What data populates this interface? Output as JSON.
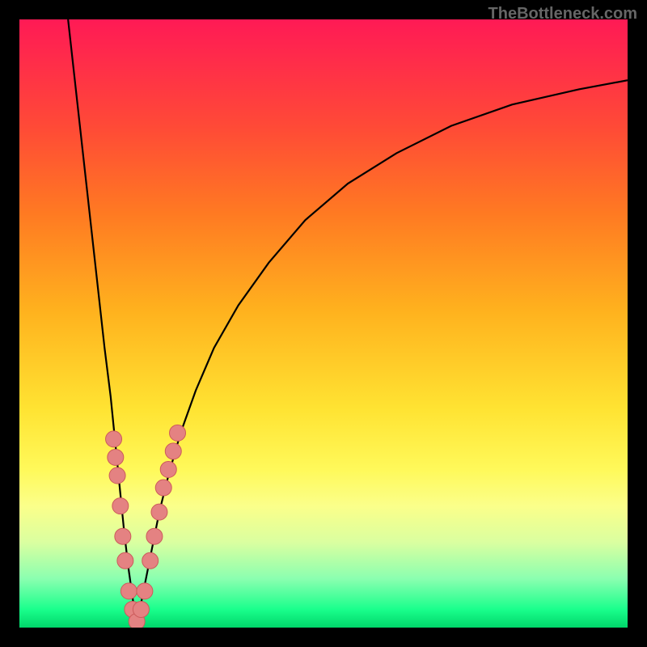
{
  "watermark": "TheBottleneck.com",
  "colors": {
    "frame": "#000000",
    "curve": "#000000",
    "marker_fill": "#e48282",
    "marker_stroke": "#cc5b5b",
    "gradient_stops": [
      {
        "offset": 0.0,
        "color": "#ff1a55"
      },
      {
        "offset": 0.06,
        "color": "#ff2a4b"
      },
      {
        "offset": 0.18,
        "color": "#ff4b36"
      },
      {
        "offset": 0.32,
        "color": "#ff7a22"
      },
      {
        "offset": 0.48,
        "color": "#ffb21e"
      },
      {
        "offset": 0.64,
        "color": "#ffe332"
      },
      {
        "offset": 0.74,
        "color": "#fff95a"
      },
      {
        "offset": 0.8,
        "color": "#fbff8a"
      },
      {
        "offset": 0.86,
        "color": "#daffa0"
      },
      {
        "offset": 0.92,
        "color": "#8affb0"
      },
      {
        "offset": 0.97,
        "color": "#1aff8c"
      },
      {
        "offset": 1.0,
        "color": "#00d66a"
      }
    ]
  },
  "chart_data": {
    "type": "line",
    "title": "",
    "xlabel": "",
    "ylabel": "",
    "ylim": [
      0,
      100
    ],
    "xlim": [
      0,
      100
    ],
    "notch_x": 19.3,
    "series": [
      {
        "name": "left-branch",
        "x": [
          8.0,
          9.0,
          10.0,
          11.0,
          12.0,
          13.0,
          14.0,
          15.0,
          15.8,
          16.5,
          17.2,
          17.9,
          18.6,
          19.3
        ],
        "y": [
          100,
          91,
          82,
          73,
          64,
          55,
          46,
          38,
          30,
          23,
          16,
          10,
          5,
          0
        ]
      },
      {
        "name": "right-branch",
        "x": [
          19.3,
          20.0,
          21.0,
          22.0,
          23.0,
          24.5,
          26.5,
          29.0,
          32.0,
          36.0,
          41.0,
          47.0,
          54.0,
          62.0,
          71.0,
          81.0,
          92.0,
          100.0
        ],
        "y": [
          0,
          4,
          9,
          14,
          19,
          25,
          32,
          39,
          46,
          53,
          60,
          67,
          73,
          78,
          82.5,
          86,
          88.5,
          90
        ]
      }
    ],
    "markers": {
      "name": "highlight-dots",
      "points": [
        {
          "x": 15.5,
          "y": 31
        },
        {
          "x": 15.8,
          "y": 28
        },
        {
          "x": 16.1,
          "y": 25
        },
        {
          "x": 16.6,
          "y": 20
        },
        {
          "x": 17.0,
          "y": 15
        },
        {
          "x": 17.4,
          "y": 11
        },
        {
          "x": 18.0,
          "y": 6
        },
        {
          "x": 18.6,
          "y": 3
        },
        {
          "x": 19.3,
          "y": 1
        },
        {
          "x": 20.0,
          "y": 3
        },
        {
          "x": 20.6,
          "y": 6
        },
        {
          "x": 21.5,
          "y": 11
        },
        {
          "x": 22.2,
          "y": 15
        },
        {
          "x": 23.0,
          "y": 19
        },
        {
          "x": 23.7,
          "y": 23
        },
        {
          "x": 24.5,
          "y": 26
        },
        {
          "x": 25.3,
          "y": 29
        },
        {
          "x": 26.0,
          "y": 32
        }
      ]
    }
  }
}
